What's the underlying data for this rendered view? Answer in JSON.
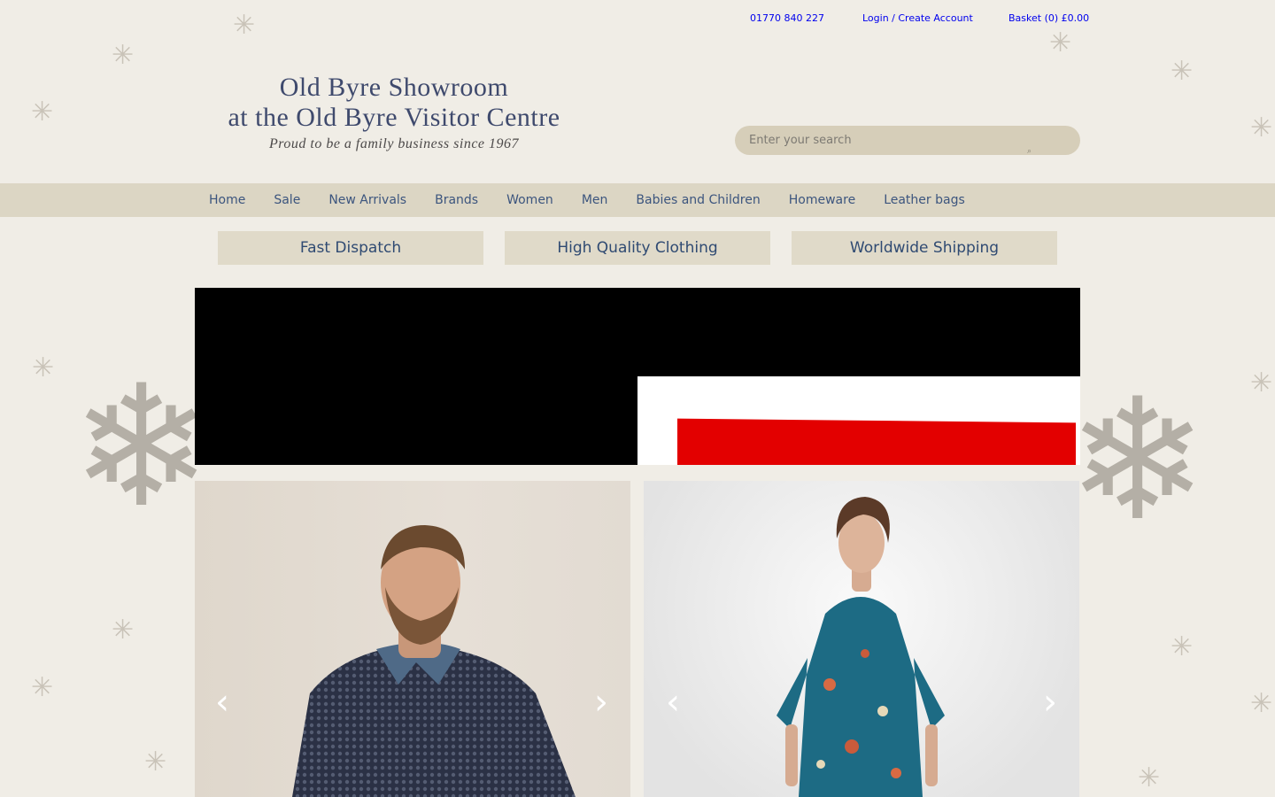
{
  "topbar": {
    "phone": "01770 840 227",
    "login": "Login / Create Account",
    "basket": "Basket (0) £0.00"
  },
  "logo": {
    "line1": "Old Byre Showroom",
    "line2": "at the Old Byre Visitor Centre",
    "tagline": "Proud to be a family business since 1967"
  },
  "search": {
    "placeholder": "Enter your search"
  },
  "nav": {
    "items": [
      "Home",
      "Sale",
      "New Arrivals",
      "Brands",
      "Women",
      "Men",
      "Babies and Children",
      "Homeware",
      "Leather bags"
    ]
  },
  "usps": [
    "Fast Dispatch",
    "High Quality Clothing",
    "Worldwide Shipping"
  ],
  "slider": {
    "prev_icon": "‹",
    "next_icon": "›"
  },
  "colors": {
    "background": "#f0ede6",
    "nav_bg": "#dcd6c4",
    "link": "#3c557e",
    "sale_red": "#e30000"
  }
}
